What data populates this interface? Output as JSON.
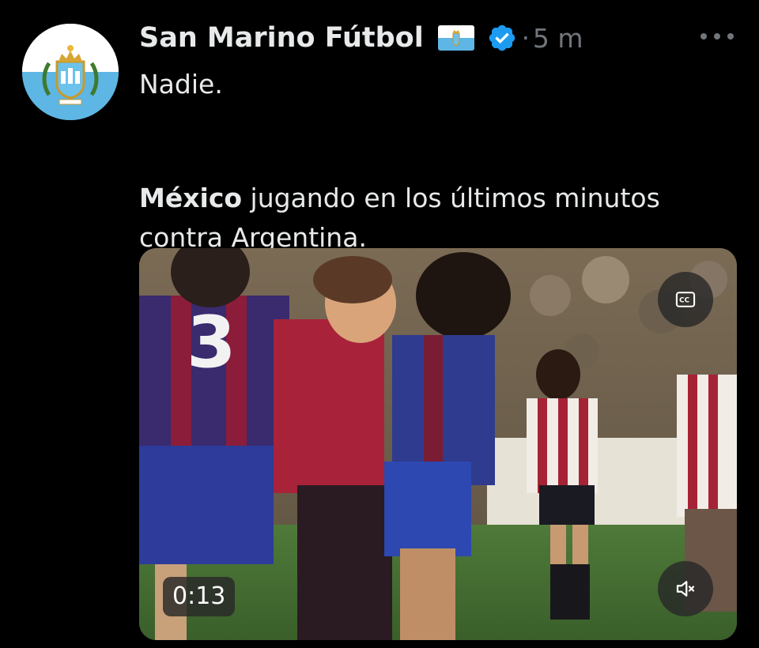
{
  "tweet": {
    "display_name": "San Marino Fútbol",
    "separator": "·",
    "time": "5 m",
    "text_line1": "Nadie.",
    "text_bold": "México",
    "text_rest": " jugando en los últimos minutos contra Argentina."
  },
  "media": {
    "duration": "0:13",
    "cc_icon": "closed-captions-icon",
    "mute_icon": "speaker-muted-icon"
  },
  "icons": {
    "verified": "verified-badge-icon",
    "more": "more-options-icon",
    "flag": "san-marino-flag-icon"
  },
  "colors": {
    "background": "#000000",
    "text": "#e7e9ea",
    "muted": "#71767b",
    "verified": "#1d9bf0",
    "flag_blue": "#5eb6e4"
  }
}
